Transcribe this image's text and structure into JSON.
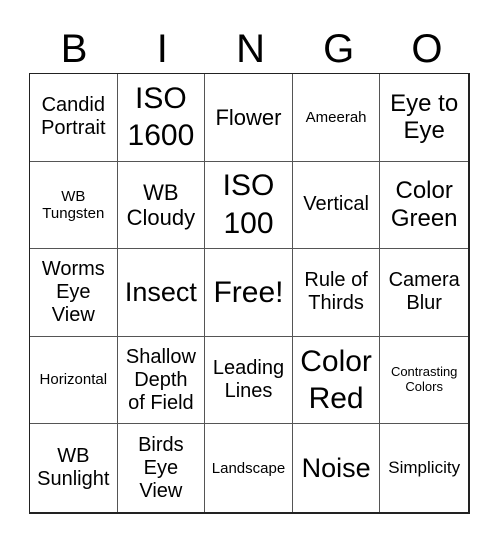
{
  "header": {
    "letters": [
      "B",
      "I",
      "N",
      "G",
      "O"
    ]
  },
  "cells": [
    "Candid\nPortrait",
    "ISO\n1600",
    "Flower",
    "Ameerah",
    "Eye to\nEye",
    "WB\nTungsten",
    "WB\nCloudy",
    "ISO\n100",
    "Vertical",
    "Color\nGreen",
    "Worms\nEye\nView",
    "Insect",
    "Free!",
    "Rule of\nThirds",
    "Camera\nBlur",
    "Horizontal",
    "Shallow\nDepth\nof Field",
    "Leading\nLines",
    "Color\nRed",
    "Contrasting\nColors",
    "WB\nSunlight",
    "Birds\nEye\nView",
    "Landscape",
    "Noise",
    "Simplicity"
  ]
}
